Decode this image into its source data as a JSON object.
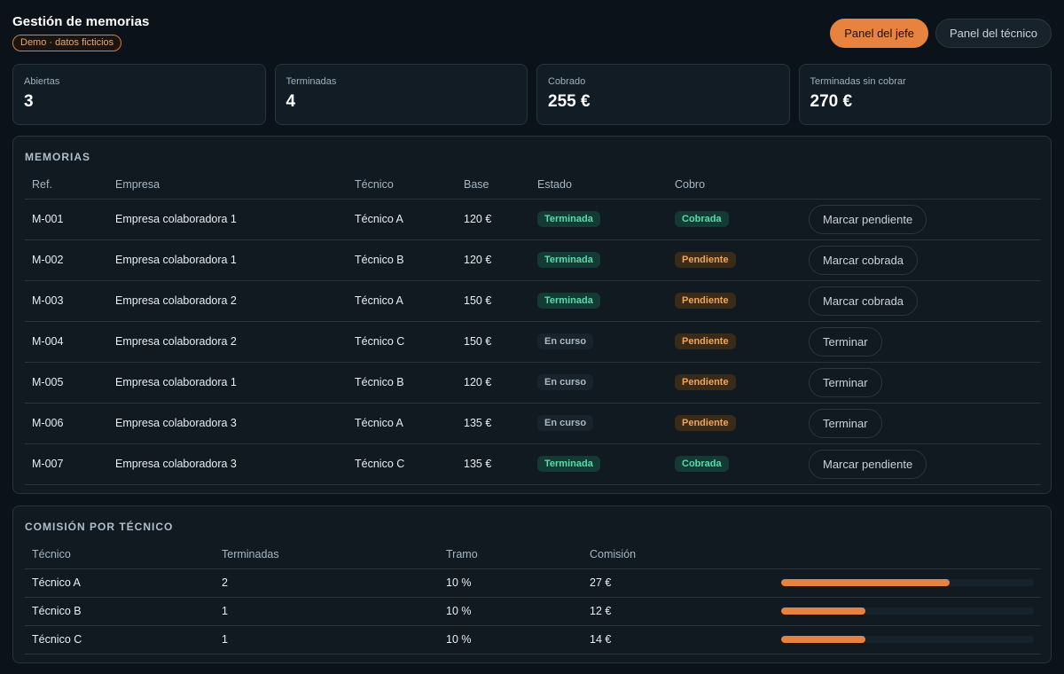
{
  "header": {
    "title": "Gestión de memorias",
    "badge": "Demo · datos ficticios",
    "role_buttons": [
      {
        "label": "Panel del jefe",
        "active": true
      },
      {
        "label": "Panel del técnico",
        "active": false
      }
    ]
  },
  "stats": [
    {
      "label": "Abiertas",
      "value": "3"
    },
    {
      "label": "Terminadas",
      "value": "4"
    },
    {
      "label": "Cobrado",
      "value": "255 €"
    },
    {
      "label": "Terminadas sin cobrar",
      "value": "270 €"
    }
  ],
  "memorias": {
    "title": "MEMORIAS",
    "columns": [
      "Ref.",
      "Empresa",
      "Técnico",
      "Base",
      "Estado",
      "Cobro"
    ],
    "rows": [
      {
        "ref": "M-001",
        "empresa": "Empresa colaboradora 1",
        "tecnico": "Técnico A",
        "base": "120 €",
        "estado": "Terminada",
        "cobro": "Cobrada",
        "accion": "Marcar pendiente"
      },
      {
        "ref": "M-002",
        "empresa": "Empresa colaboradora 1",
        "tecnico": "Técnico B",
        "base": "120 €",
        "estado": "Terminada",
        "cobro": "Pendiente",
        "accion": "Marcar cobrada"
      },
      {
        "ref": "M-003",
        "empresa": "Empresa colaboradora 2",
        "tecnico": "Técnico A",
        "base": "150 €",
        "estado": "Terminada",
        "cobro": "Pendiente",
        "accion": "Marcar cobrada"
      },
      {
        "ref": "M-004",
        "empresa": "Empresa colaboradora 2",
        "tecnico": "Técnico C",
        "base": "150 €",
        "estado": "En curso",
        "cobro": "Pendiente",
        "accion": "Terminar"
      },
      {
        "ref": "M-005",
        "empresa": "Empresa colaboradora 1",
        "tecnico": "Técnico B",
        "base": "120 €",
        "estado": "En curso",
        "cobro": "Pendiente",
        "accion": "Terminar"
      },
      {
        "ref": "M-006",
        "empresa": "Empresa colaboradora 3",
        "tecnico": "Técnico A",
        "base": "135 €",
        "estado": "En curso",
        "cobro": "Pendiente",
        "accion": "Terminar"
      },
      {
        "ref": "M-007",
        "empresa": "Empresa colaboradora 3",
        "tecnico": "Técnico C",
        "base": "135 €",
        "estado": "Terminada",
        "cobro": "Cobrada",
        "accion": "Marcar pendiente"
      }
    ]
  },
  "comision": {
    "title": "COMISIÓN POR TÉCNICO",
    "columns": [
      "Técnico",
      "Terminadas",
      "Tramo",
      "Comisión"
    ],
    "rows": [
      {
        "tecnico": "Técnico A",
        "terminadas": "2",
        "tramo": "10 %",
        "comision": "27 €",
        "fraction": 0.667
      },
      {
        "tecnico": "Técnico B",
        "terminadas": "1",
        "tramo": "10 %",
        "comision": "12 €",
        "fraction": 0.333
      },
      {
        "tecnico": "Técnico C",
        "terminadas": "1",
        "tramo": "10 %",
        "comision": "14 €",
        "fraction": 0.333
      }
    ]
  },
  "colors": {
    "accent": "#e8823f",
    "success": "#58dcae",
    "warning": "#f1a557",
    "background": "#0b1219"
  }
}
